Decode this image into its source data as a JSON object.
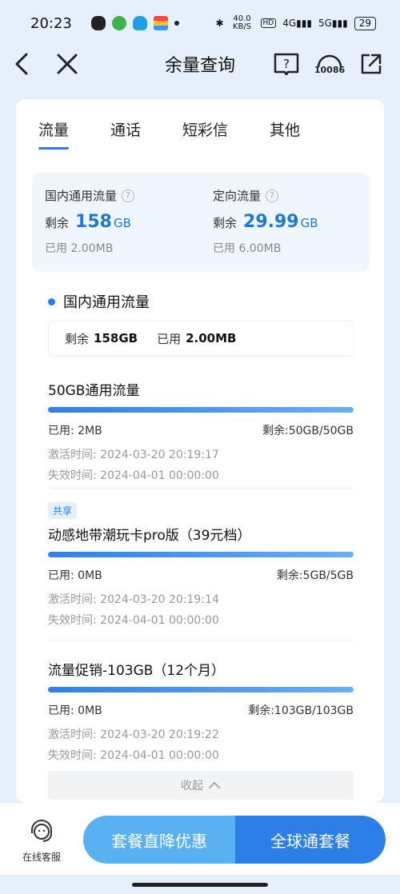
{
  "status": {
    "time": "20:23",
    "net_speed": "40.0 KB/S",
    "battery": "29"
  },
  "nav": {
    "title": "余量查询",
    "hotline": "10086"
  },
  "tabs": [
    {
      "label": "流量",
      "active": true
    },
    {
      "label": "通话",
      "active": false
    },
    {
      "label": "短彩信",
      "active": false
    },
    {
      "label": "其他",
      "active": false
    }
  ],
  "summary": {
    "domestic": {
      "title": "国内通用流量",
      "remain_label": "剩余",
      "remain_value": "158",
      "remain_unit": "GB",
      "used": "已用  2.00MB"
    },
    "directed": {
      "title": "定向流量",
      "remain_label": "剩余",
      "remain_value": "29.99",
      "remain_unit": "GB",
      "used": "已用  6.00MB"
    }
  },
  "section": {
    "title": "国内通用流量",
    "remain_label": "剩余",
    "remain_value": "158GB",
    "used_label": "已用",
    "used_value": "2.00MB"
  },
  "packages": [
    {
      "tag": "",
      "name": "50GB通用流量",
      "used": "已用: 2MB",
      "remain": "剩余:50GB/50GB",
      "activated": "激活时间: 2024-03-20 20:19:17",
      "expires": "失效时间: 2024-04-01 00:00:00"
    },
    {
      "tag": "共享",
      "name": "动感地带潮玩卡pro版（39元档）",
      "used": "已用: 0MB",
      "remain": "剩余:5GB/5GB",
      "activated": "激活时间: 2024-03-20 20:19:14",
      "expires": "失效时间: 2024-04-01 00:00:00"
    },
    {
      "tag": "",
      "name": "流量促销-103GB（12个月）",
      "used": "已用: 0MB",
      "remain": "剩余:103GB/103GB",
      "activated": "激活时间: 2024-03-20 20:19:22",
      "expires": "失效时间: 2024-04-01 00:00:00"
    }
  ],
  "collapse_label": "收起",
  "bottom": {
    "service_label": "在线客服",
    "cta_left": "套餐直降优惠",
    "cta_right": "全球通套餐"
  }
}
